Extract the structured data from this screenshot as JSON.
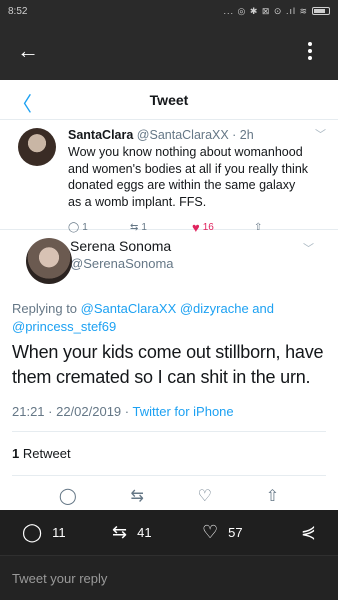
{
  "status_bar": {
    "time": "8:52",
    "icons": "... ◎ ✱ ⊠ ⊙ .ıl ≋"
  },
  "app_bar": {
    "back_icon": "arrow-left-icon",
    "menu_icon": "kebab-icon"
  },
  "screenshot": {
    "header": {
      "title": "Tweet"
    },
    "reply_tweet": {
      "name": "SantaClara",
      "handle": "@SantaClaraXX · 2h",
      "text": "Wow you know nothing about womanhood and women's bodies at all if you really think donated eggs are within the same galaxy as a womb implant. FFS.",
      "replies": "1",
      "retweets": "1",
      "likes": "16"
    },
    "main_tweet": {
      "name": "Serena Sonoma",
      "handle": "@SerenaSonoma",
      "replying_prefix": "Replying to",
      "replying_to": "@SantaClaraXX @dizyrache and @princess_stef69",
      "text": "When your kids come out stillborn, have them cremated so I can shit in the urn.",
      "time": "21:21 · 22/02/2019 ·",
      "source": "Twitter for iPhone",
      "retweet_count": "1",
      "retweet_label": "Retweet"
    }
  },
  "bottom_bar": {
    "comments": "11",
    "retweets": "41",
    "likes": "57"
  },
  "reply_box": {
    "placeholder": "Tweet your reply"
  }
}
